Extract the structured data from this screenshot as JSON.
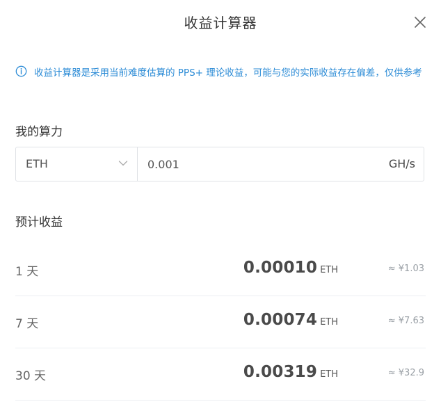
{
  "header": {
    "title": "收益计算器",
    "close_icon": "close-icon"
  },
  "notice": {
    "icon": "info-icon",
    "text": "收益计算器是采用当前难度估算的 PPS+ 理论收益，可能与您的实际收益存在偏差，仅供参考"
  },
  "hashrate": {
    "label": "我的算力",
    "coin": "ETH",
    "value": "0.001",
    "unit": "GH/s"
  },
  "earnings": {
    "label": "预计收益",
    "rows": [
      {
        "period": "1 天",
        "amount": "0.00010",
        "unit": "ETH",
        "fiat": "≈ ¥1.03"
      },
      {
        "period": "7 天",
        "amount": "0.00074",
        "unit": "ETH",
        "fiat": "≈ ¥7.63"
      },
      {
        "period": "30 天",
        "amount": "0.00319",
        "unit": "ETH",
        "fiat": "≈ ¥32.9"
      }
    ]
  },
  "colors": {
    "accent": "#2b8bd6",
    "text": "#333333",
    "muted": "#9aa0a6",
    "border": "#dfe2e6"
  }
}
